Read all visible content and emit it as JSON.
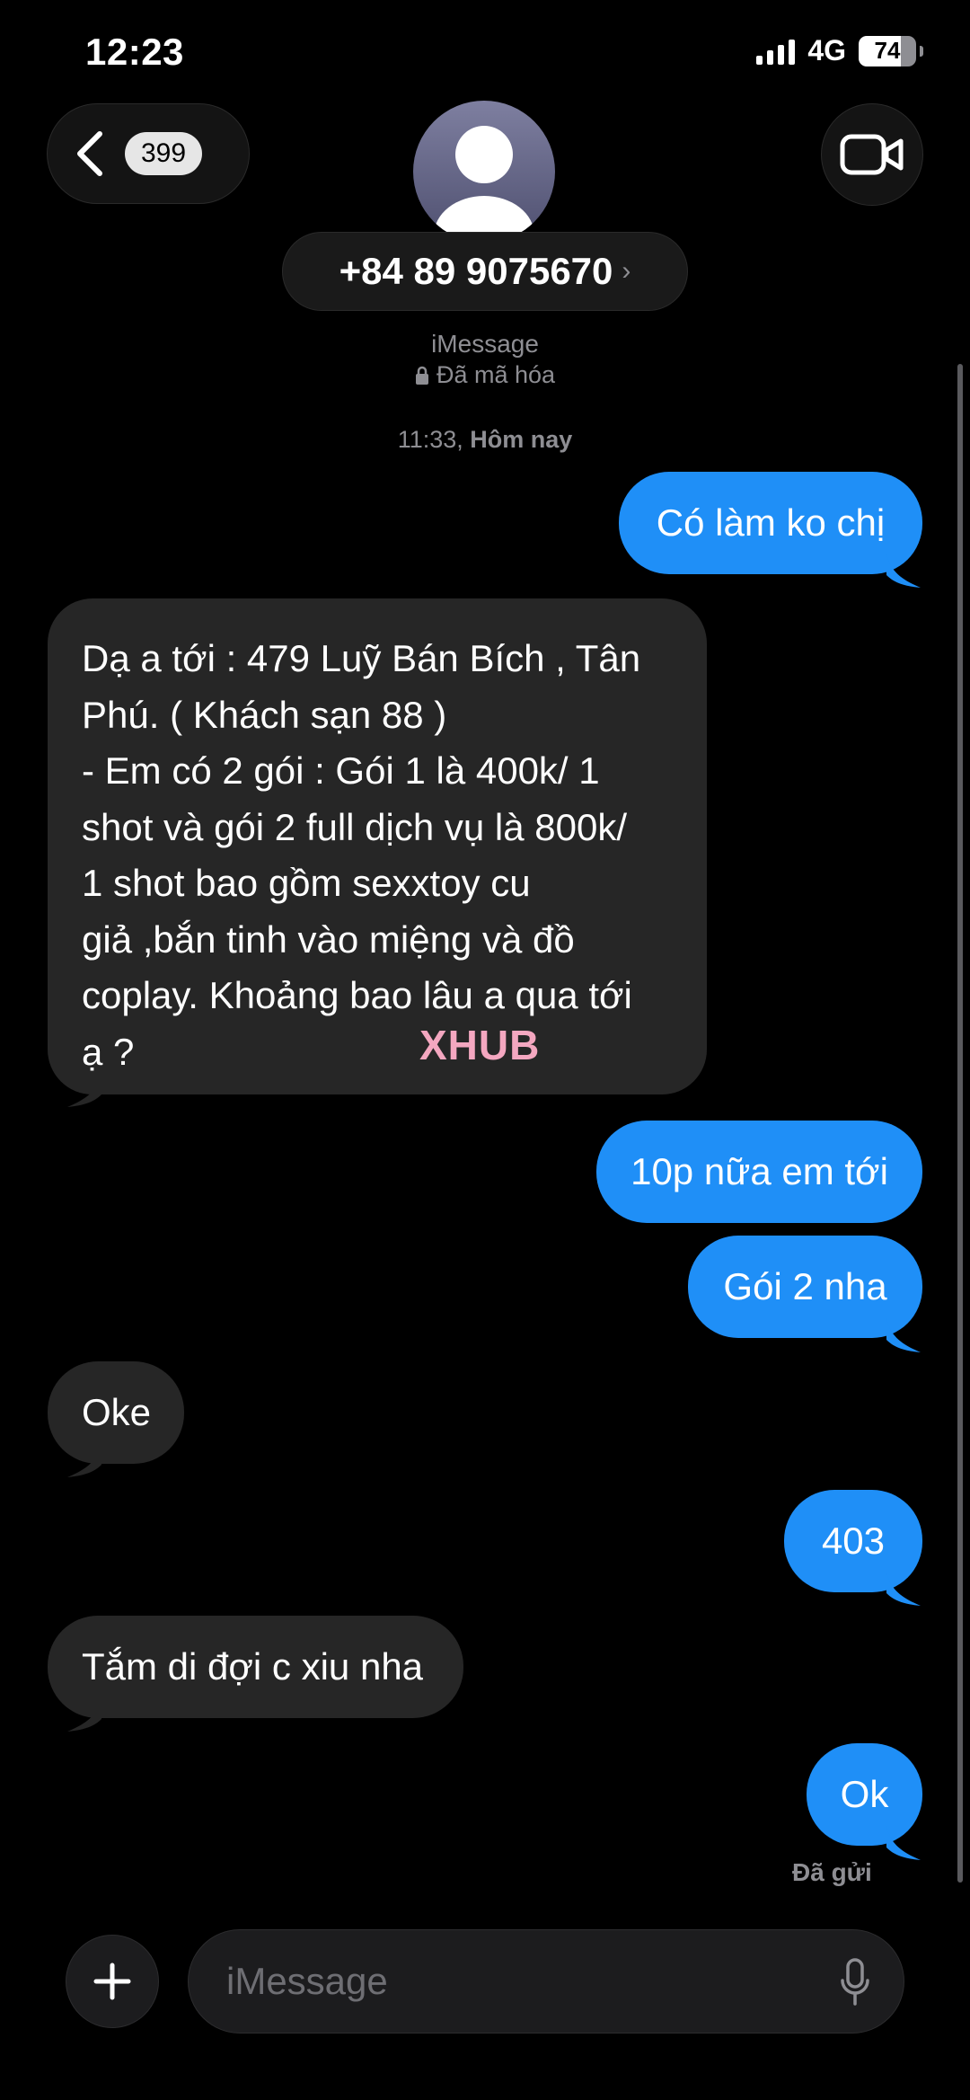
{
  "status_bar": {
    "time": "12:23",
    "network": "4G",
    "battery": "74",
    "battery_level": 0.74
  },
  "header": {
    "back_badge": "399",
    "contact": "+84 89 9075670",
    "contact_chevron": "›",
    "service": "iMessage",
    "encryption": "Đã mã hóa",
    "icons": [
      "chevron-left-icon",
      "person-icon",
      "video-icon",
      "lock-icon"
    ]
  },
  "thread": {
    "timestamp_time": "11:33,",
    "timestamp_day": "Hôm nay",
    "messages": [
      {
        "dir": "out",
        "text": "Có làm ko chị"
      },
      {
        "dir": "in",
        "lines": [
          "Dạ a tới : 479 Luỹ Bán Bích , Tân",
          "Phú. ( Khách sạn 88 )",
          "- Em có 2 gói : Gói 1 là 400k/ 1",
          "shot và gói 2 full dịch vụ là 800k/",
          "1 shot bao gồm sexxtoy cu",
          "giả ,bắn tinh vào miệng và đồ",
          "coplay. Khoảng bao lâu a qua tới",
          "ạ ?"
        ]
      },
      {
        "dir": "out",
        "text": "10p nữa em tới"
      },
      {
        "dir": "out",
        "text": "Gói 2 nha"
      },
      {
        "dir": "in",
        "text": "Oke"
      },
      {
        "dir": "out",
        "text": "403"
      },
      {
        "dir": "in",
        "text": "Tắm di đợi c xiu nha"
      },
      {
        "dir": "out",
        "text": "Ok"
      }
    ],
    "delivered": "Đã gửi",
    "watermark": "XHUB"
  },
  "composer": {
    "placeholder": "iMessage",
    "icons": [
      "plus-icon",
      "microphone-icon"
    ]
  },
  "colors": {
    "outgoing": "#1f8ff7",
    "incoming": "#262626",
    "background": "#000000"
  }
}
